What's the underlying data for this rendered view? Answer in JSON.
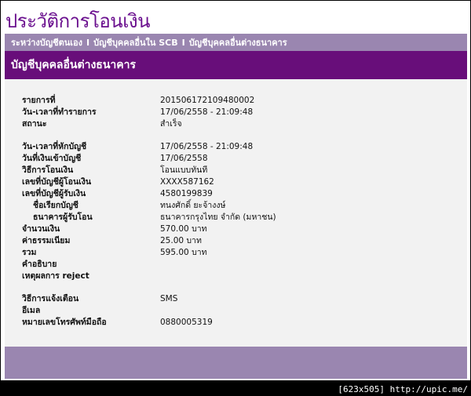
{
  "page": {
    "title": "ประวัติการโอนเงิน"
  },
  "nav": {
    "items": [
      "ระหว่างบัญชีตนเอง",
      "บัญชีบุคคลอื่นใน SCB",
      "บัญชีบุคคลอื่นต่างธนาคาร"
    ],
    "separator": "I"
  },
  "panel": {
    "heading": "บัญชีบุคคลอื่นต่างธนาคาร"
  },
  "details": {
    "rows": [
      {
        "label": "รายการที่",
        "value": "201506172109480002"
      },
      {
        "label": "วัน-เวลาที่ทำรายการ",
        "value": "17/06/2558 - 21:09:48"
      },
      {
        "label": "สถานะ",
        "value": "สำเร็จ"
      },
      {
        "label": "วัน-เวลาที่หักบัญชี",
        "value": "17/06/2558 - 21:09:48"
      },
      {
        "label": "วันที่เงินเข้าบัญชี",
        "value": "17/06/2558"
      },
      {
        "label": "วิธีการโอนเงิน",
        "value": "โอนแบบทันที"
      },
      {
        "label": "เลขที่บัญชีผู้โอนเงิน",
        "value": "XXXX587162"
      },
      {
        "label": "เลขที่บัญชีผู้รับเงิน",
        "value": "4580199839"
      },
      {
        "label": "ชื่อเรียกบัญชี",
        "value": "ทนงศักดิ์ ยะจ้างงษ์"
      },
      {
        "label": "ธนาคารผู้รับโอน",
        "value": "ธนาคารกรุงไทย จำกัด (มหาชน)"
      },
      {
        "label": "จำนวนเงิน",
        "value": "570.00  บาท"
      },
      {
        "label": "ค่าธรรมเนียม",
        "value": "25.00  บาท"
      },
      {
        "label": "รวม",
        "value": "595.00  บาท"
      },
      {
        "label": "คำอธิบาย",
        "value": ""
      },
      {
        "label": "เหตุผลการ reject",
        "value": ""
      },
      {
        "label": "วิธีการแจ้งเตือน",
        "value": "SMS"
      },
      {
        "label": "อีเมล",
        "value": ""
      },
      {
        "label": "หมายเลขโทรศัพท์มือถือ",
        "value": "0880005319"
      }
    ]
  },
  "watermark": {
    "text": "[623x505] http://upic.me/"
  }
}
